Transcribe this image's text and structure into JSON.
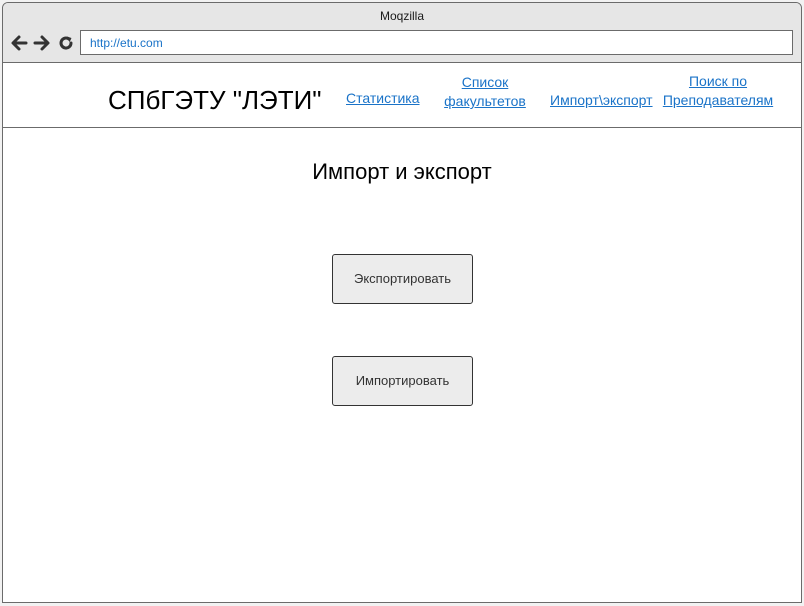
{
  "window": {
    "title": "Moqzilla"
  },
  "toolbar": {
    "back_icon": "arrow-left-icon",
    "forward_icon": "arrow-right-icon",
    "reload_icon": "reload-icon",
    "url": "http://etu.com"
  },
  "header": {
    "site_title": "СПбГЭТУ \"ЛЭТИ\"",
    "nav": {
      "statistics": "Статистика",
      "faculties_line1": "Список ",
      "faculties_line2": "факультетов",
      "import_export": "Импорт\\экспорт",
      "search_line1": "Поиск по ",
      "search_line2": "Преподавателям"
    }
  },
  "main": {
    "heading": "Импорт и экспорт",
    "export_button": "Экспортировать",
    "import_button": "Импортировать"
  },
  "colors": {
    "link": "#1a73c8",
    "chrome": "#e6e6e6",
    "button_bg": "#ececec",
    "border": "#6b6b6b"
  }
}
